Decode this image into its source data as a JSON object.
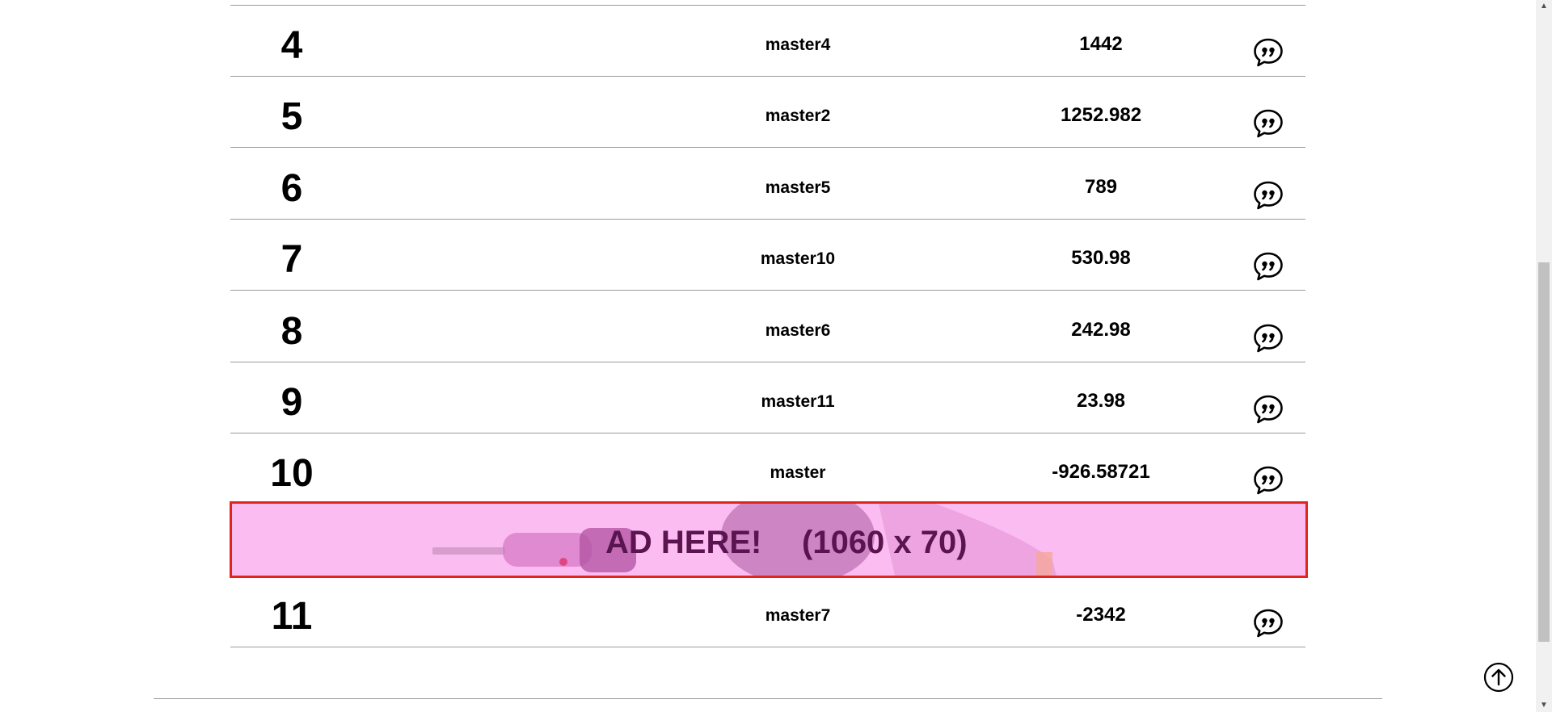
{
  "ranking": {
    "rows": [
      {
        "rank": "4",
        "name": "master4",
        "score": "1442"
      },
      {
        "rank": "5",
        "name": "master2",
        "score": "1252.982"
      },
      {
        "rank": "6",
        "name": "master5",
        "score": "789"
      },
      {
        "rank": "7",
        "name": "master10",
        "score": "530.98"
      },
      {
        "rank": "8",
        "name": "master6",
        "score": "242.98"
      },
      {
        "rank": "9",
        "name": "master11",
        "score": "23.98"
      },
      {
        "rank": "10",
        "name": "master",
        "score": "-926.58721"
      },
      {
        "rank": "11",
        "name": "master7",
        "score": "-2342"
      }
    ],
    "comment_icon": "speech-bubble-quote-icon"
  },
  "ad": {
    "label": "AD HERE!",
    "size": "(1060 x 70)",
    "background_color": "#fbbcf2",
    "border_color": "#e0261c"
  },
  "back_to_top": {
    "icon": "arrow-up-circle-icon"
  },
  "scrollbar": {
    "up_glyph": "▲",
    "down_glyph": "▼"
  }
}
